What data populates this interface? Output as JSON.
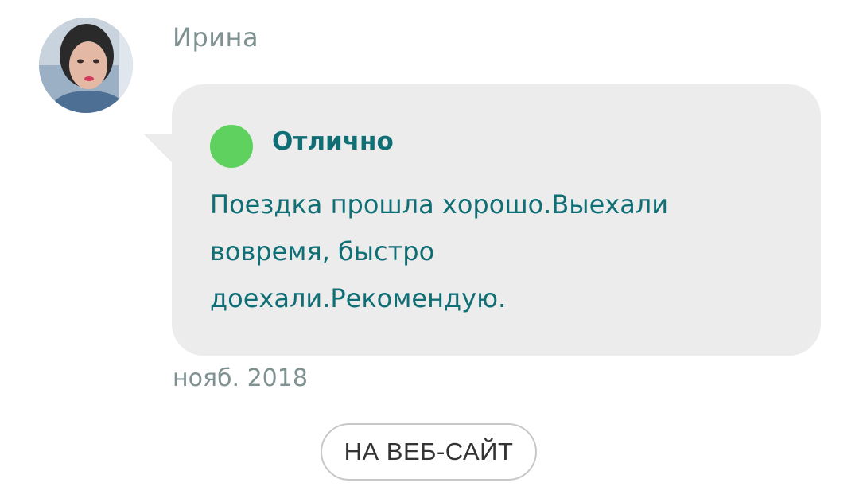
{
  "review": {
    "author": "Ирина",
    "avatar_icon": "user-photo-avatar",
    "rating_color": "#5fd15f",
    "rating_label": "Отлично",
    "text": "Поездка прошла хорошо.Выехали\nвовремя, быстро\nдоехали.Рекомендую.",
    "date": "нояб. 2018"
  },
  "actions": {
    "website_button_label": "НА ВЕБ-САЙТ"
  },
  "colors": {
    "accent_text": "#0f6f75",
    "muted_text": "#7f9191",
    "bubble_bg": "#ececec"
  }
}
